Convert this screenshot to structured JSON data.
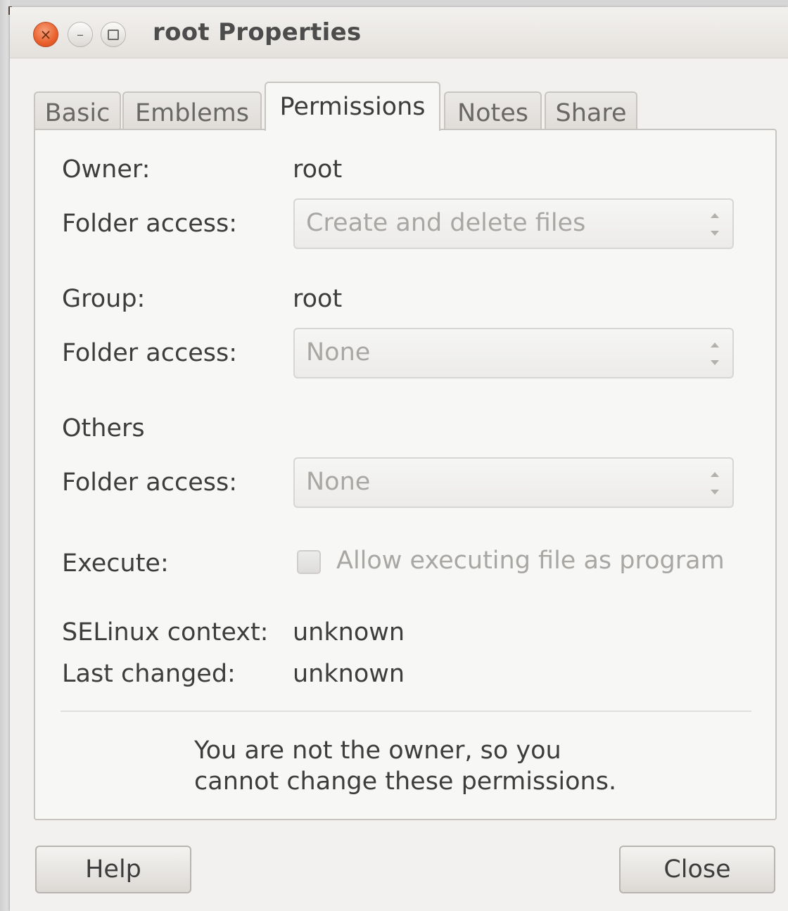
{
  "window": {
    "title": "root Properties",
    "close_glyph": "×",
    "minimize_glyph": "–"
  },
  "tabs": [
    {
      "label": "Basic"
    },
    {
      "label": "Emblems"
    },
    {
      "label": "Permissions",
      "active": true
    },
    {
      "label": "Notes"
    },
    {
      "label": "Share"
    }
  ],
  "owner": {
    "label": "Owner:",
    "value": "root",
    "access_label": "Folder access:",
    "access_value": "Create and delete files"
  },
  "group": {
    "label": "Group:",
    "value": "root",
    "access_label": "Folder access:",
    "access_value": "None"
  },
  "others": {
    "label": "Others",
    "access_label": "Folder access:",
    "access_value": "None"
  },
  "execute": {
    "label": "Execute:",
    "checkbox_label": "Allow executing file as program",
    "checked": false
  },
  "selinux": {
    "label": "SELinux context:",
    "value": "unknown"
  },
  "last_changed": {
    "label": "Last changed:",
    "value": "unknown"
  },
  "notice": {
    "line1": "You are not the owner, so you",
    "line2": "cannot change these permissions."
  },
  "buttons": {
    "help": "Help",
    "close": "Close"
  },
  "colors": {
    "close_button": "#e9602c",
    "window_bg": "#f2f1f0",
    "disabled_text": "#a9a7a4"
  }
}
